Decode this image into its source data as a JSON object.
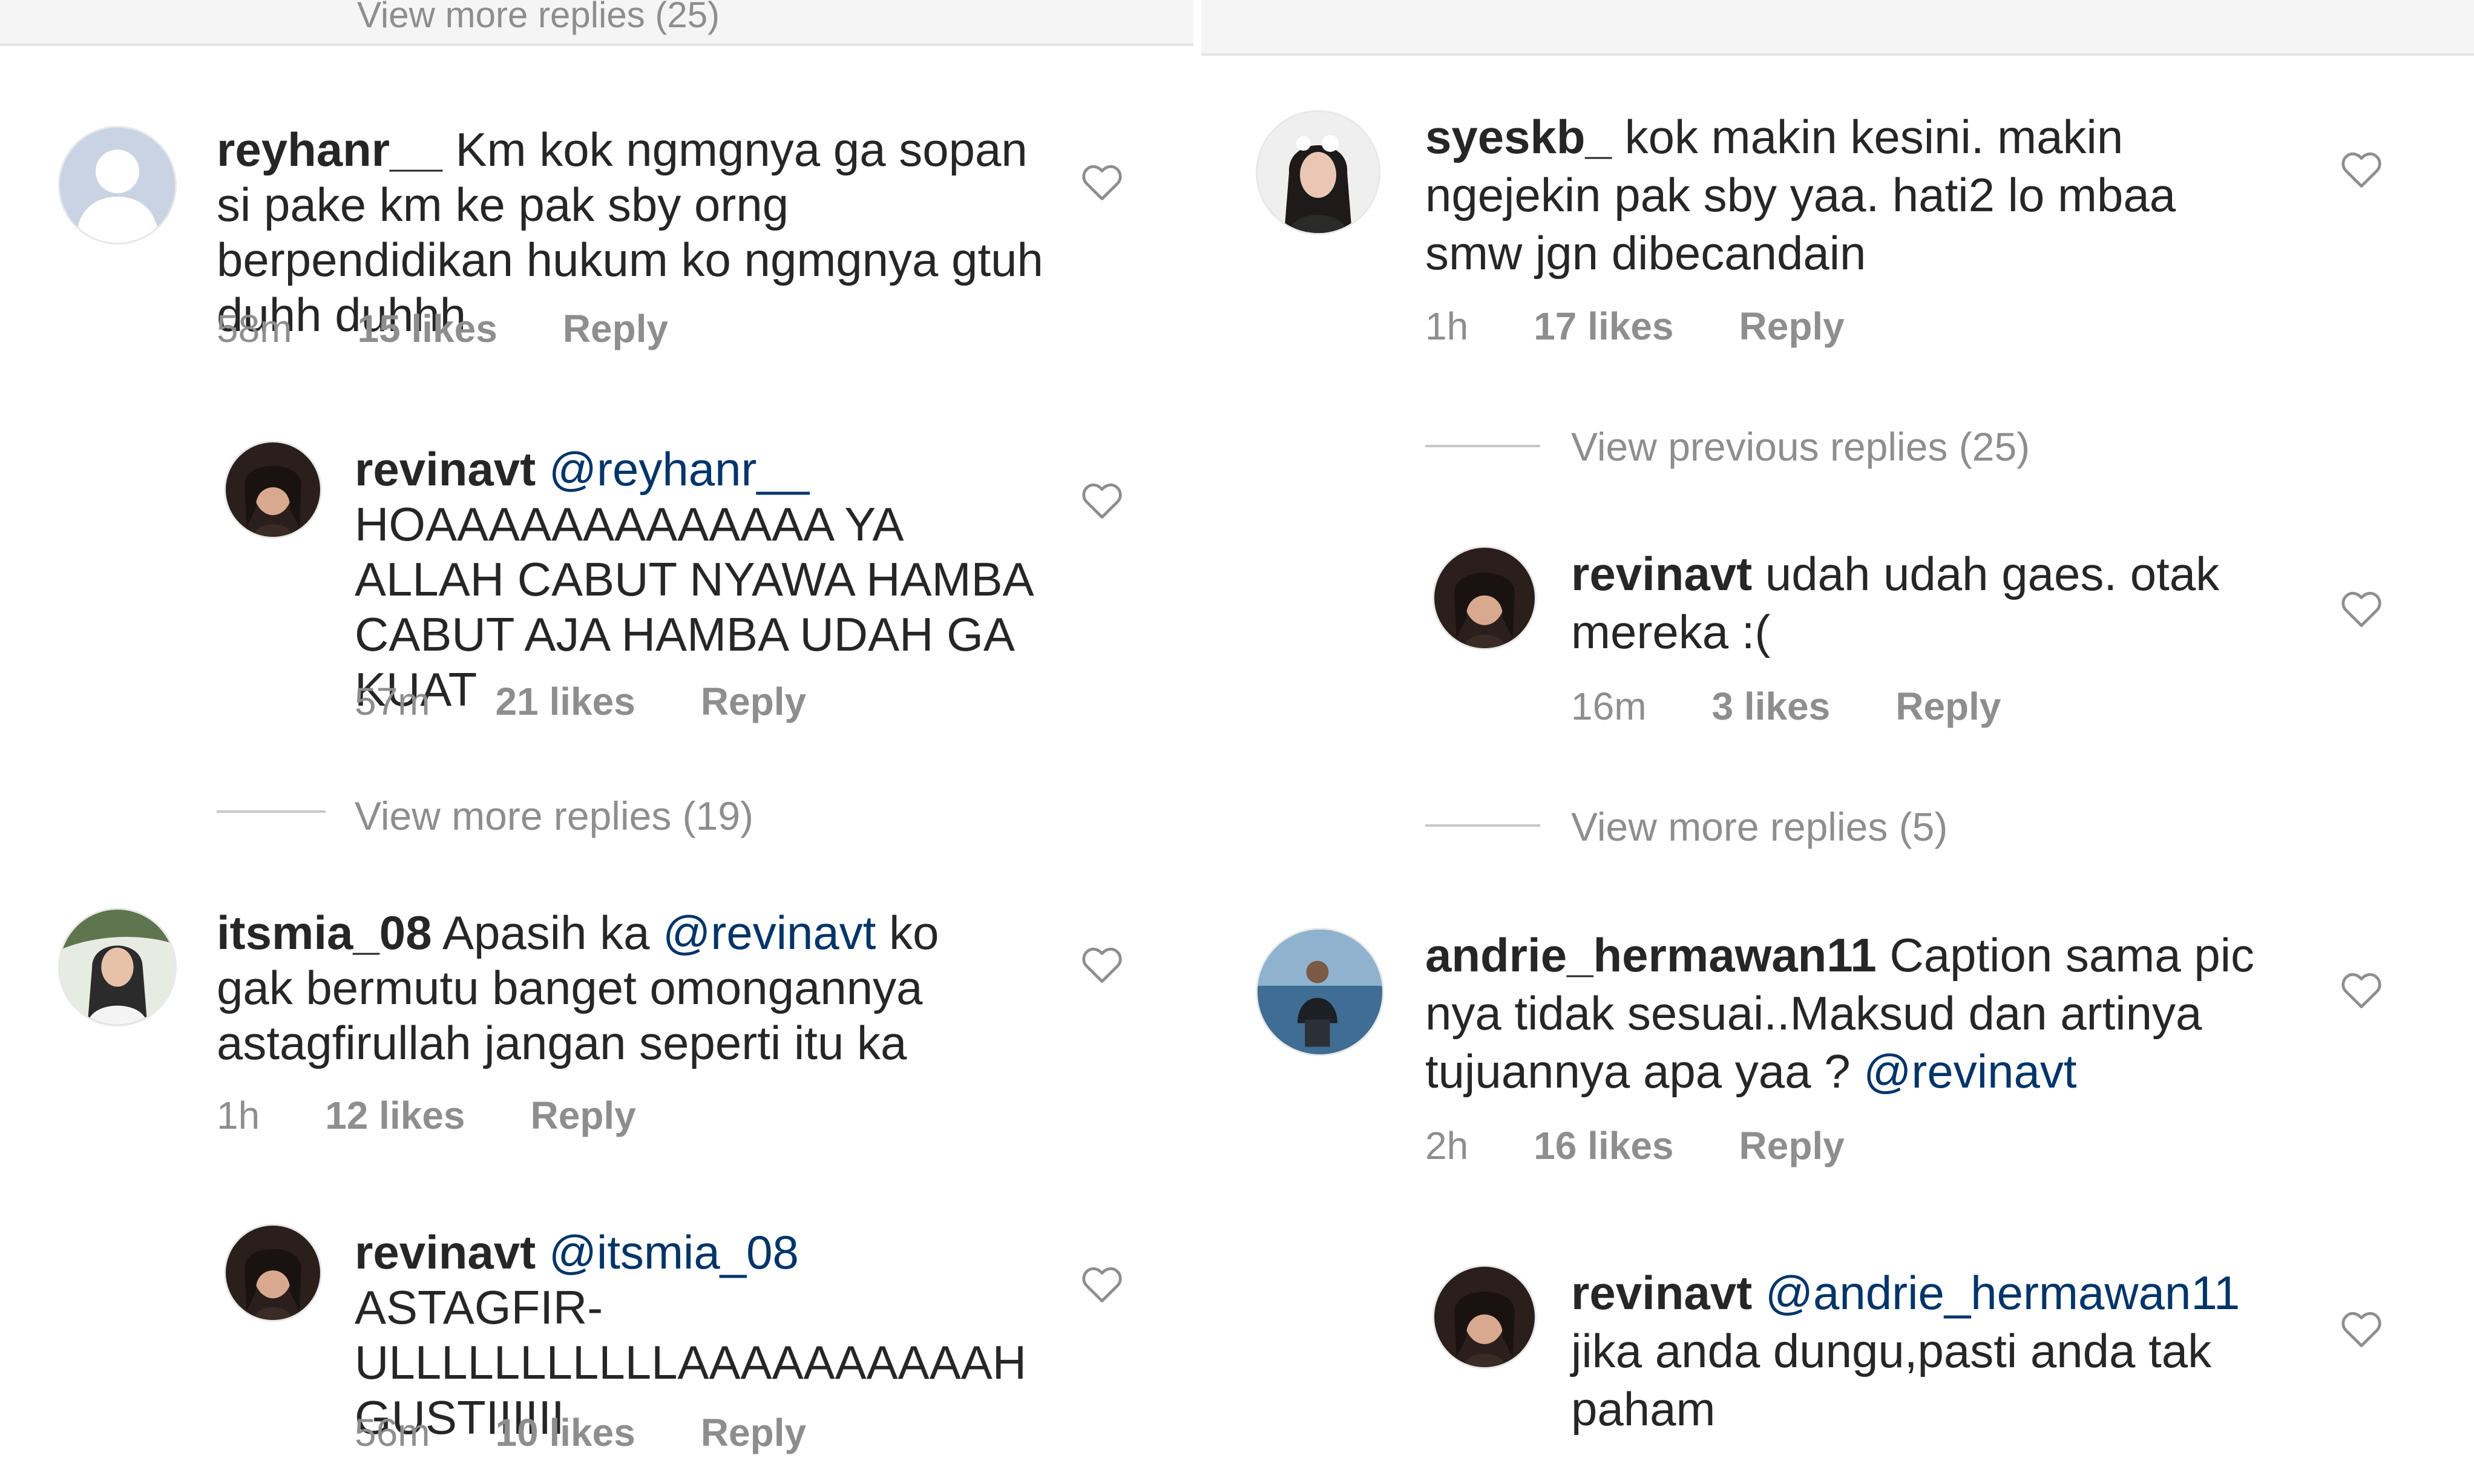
{
  "left": {
    "top_cut_text": "View more replies (25)",
    "comments": [
      {
        "username": "reyhanr__",
        "text": "Km kok ngmgnya ga sopan si pake km ke pak sby orng berpendidikan hukum ko ngmgnya gtuh duhh duhhh",
        "time": "58m",
        "likes": "15 likes",
        "reply": "Reply"
      },
      {
        "username": "revinavt",
        "mention": "@reyhanr__",
        "text": "HOAAAAAAAAAAAAA YA ALLAH CABUT NYAWA HAMBA CABUT AJA HAMBA UDAH GA KUAT",
        "time": "57m",
        "likes": "21 likes",
        "reply": "Reply"
      },
      {
        "username": "itsmia_08",
        "text_before": "Apasih ka",
        "mention": "@revinavt",
        "text_after": "ko gak bermutu banget omongannya astagfirullah jangan seperti itu ka",
        "time": "1h",
        "likes": "12 likes",
        "reply": "Reply"
      },
      {
        "username": "revinavt",
        "mention": "@itsmia_08",
        "text": "ASTAGFIR-ULLLLLLLLLLLAAAAAAAAAAH GUSTIIIIII",
        "time": "56m",
        "likes": "10 likes",
        "reply": "Reply"
      }
    ],
    "view_more": "View more replies (19)"
  },
  "right": {
    "comments": [
      {
        "username": "syeskb_",
        "text": "kok makin kesini. makin ngejekin pak sby yaa. hati2 lo mbaa smw jgn dibecandain",
        "time": "1h",
        "likes": "17 likes",
        "reply": "Reply"
      },
      {
        "username": "revinavt",
        "text": "udah udah gaes. otak mereka :(",
        "time": "16m",
        "likes": "3 likes",
        "reply": "Reply"
      },
      {
        "username": "andrie_hermawan11",
        "text": "Caption sama pic nya tidak sesuai..Maksud dan artinya tujuannya apa yaa ?",
        "mention": "@revinavt",
        "time": "2h",
        "likes": "16 likes",
        "reply": "Reply"
      },
      {
        "username": "revinavt",
        "mention": "@andrie_hermawan11",
        "text": "jika anda dungu,pasti anda tak paham"
      }
    ],
    "view_previous": "View previous replies (25)",
    "view_more": "View more replies (5)"
  },
  "icons": {
    "like": "heart-outline-icon",
    "default_avatar": "default-avatar-icon"
  },
  "colors": {
    "text": "#262626",
    "meta": "#8e8e8e",
    "mention": "#003569"
  }
}
